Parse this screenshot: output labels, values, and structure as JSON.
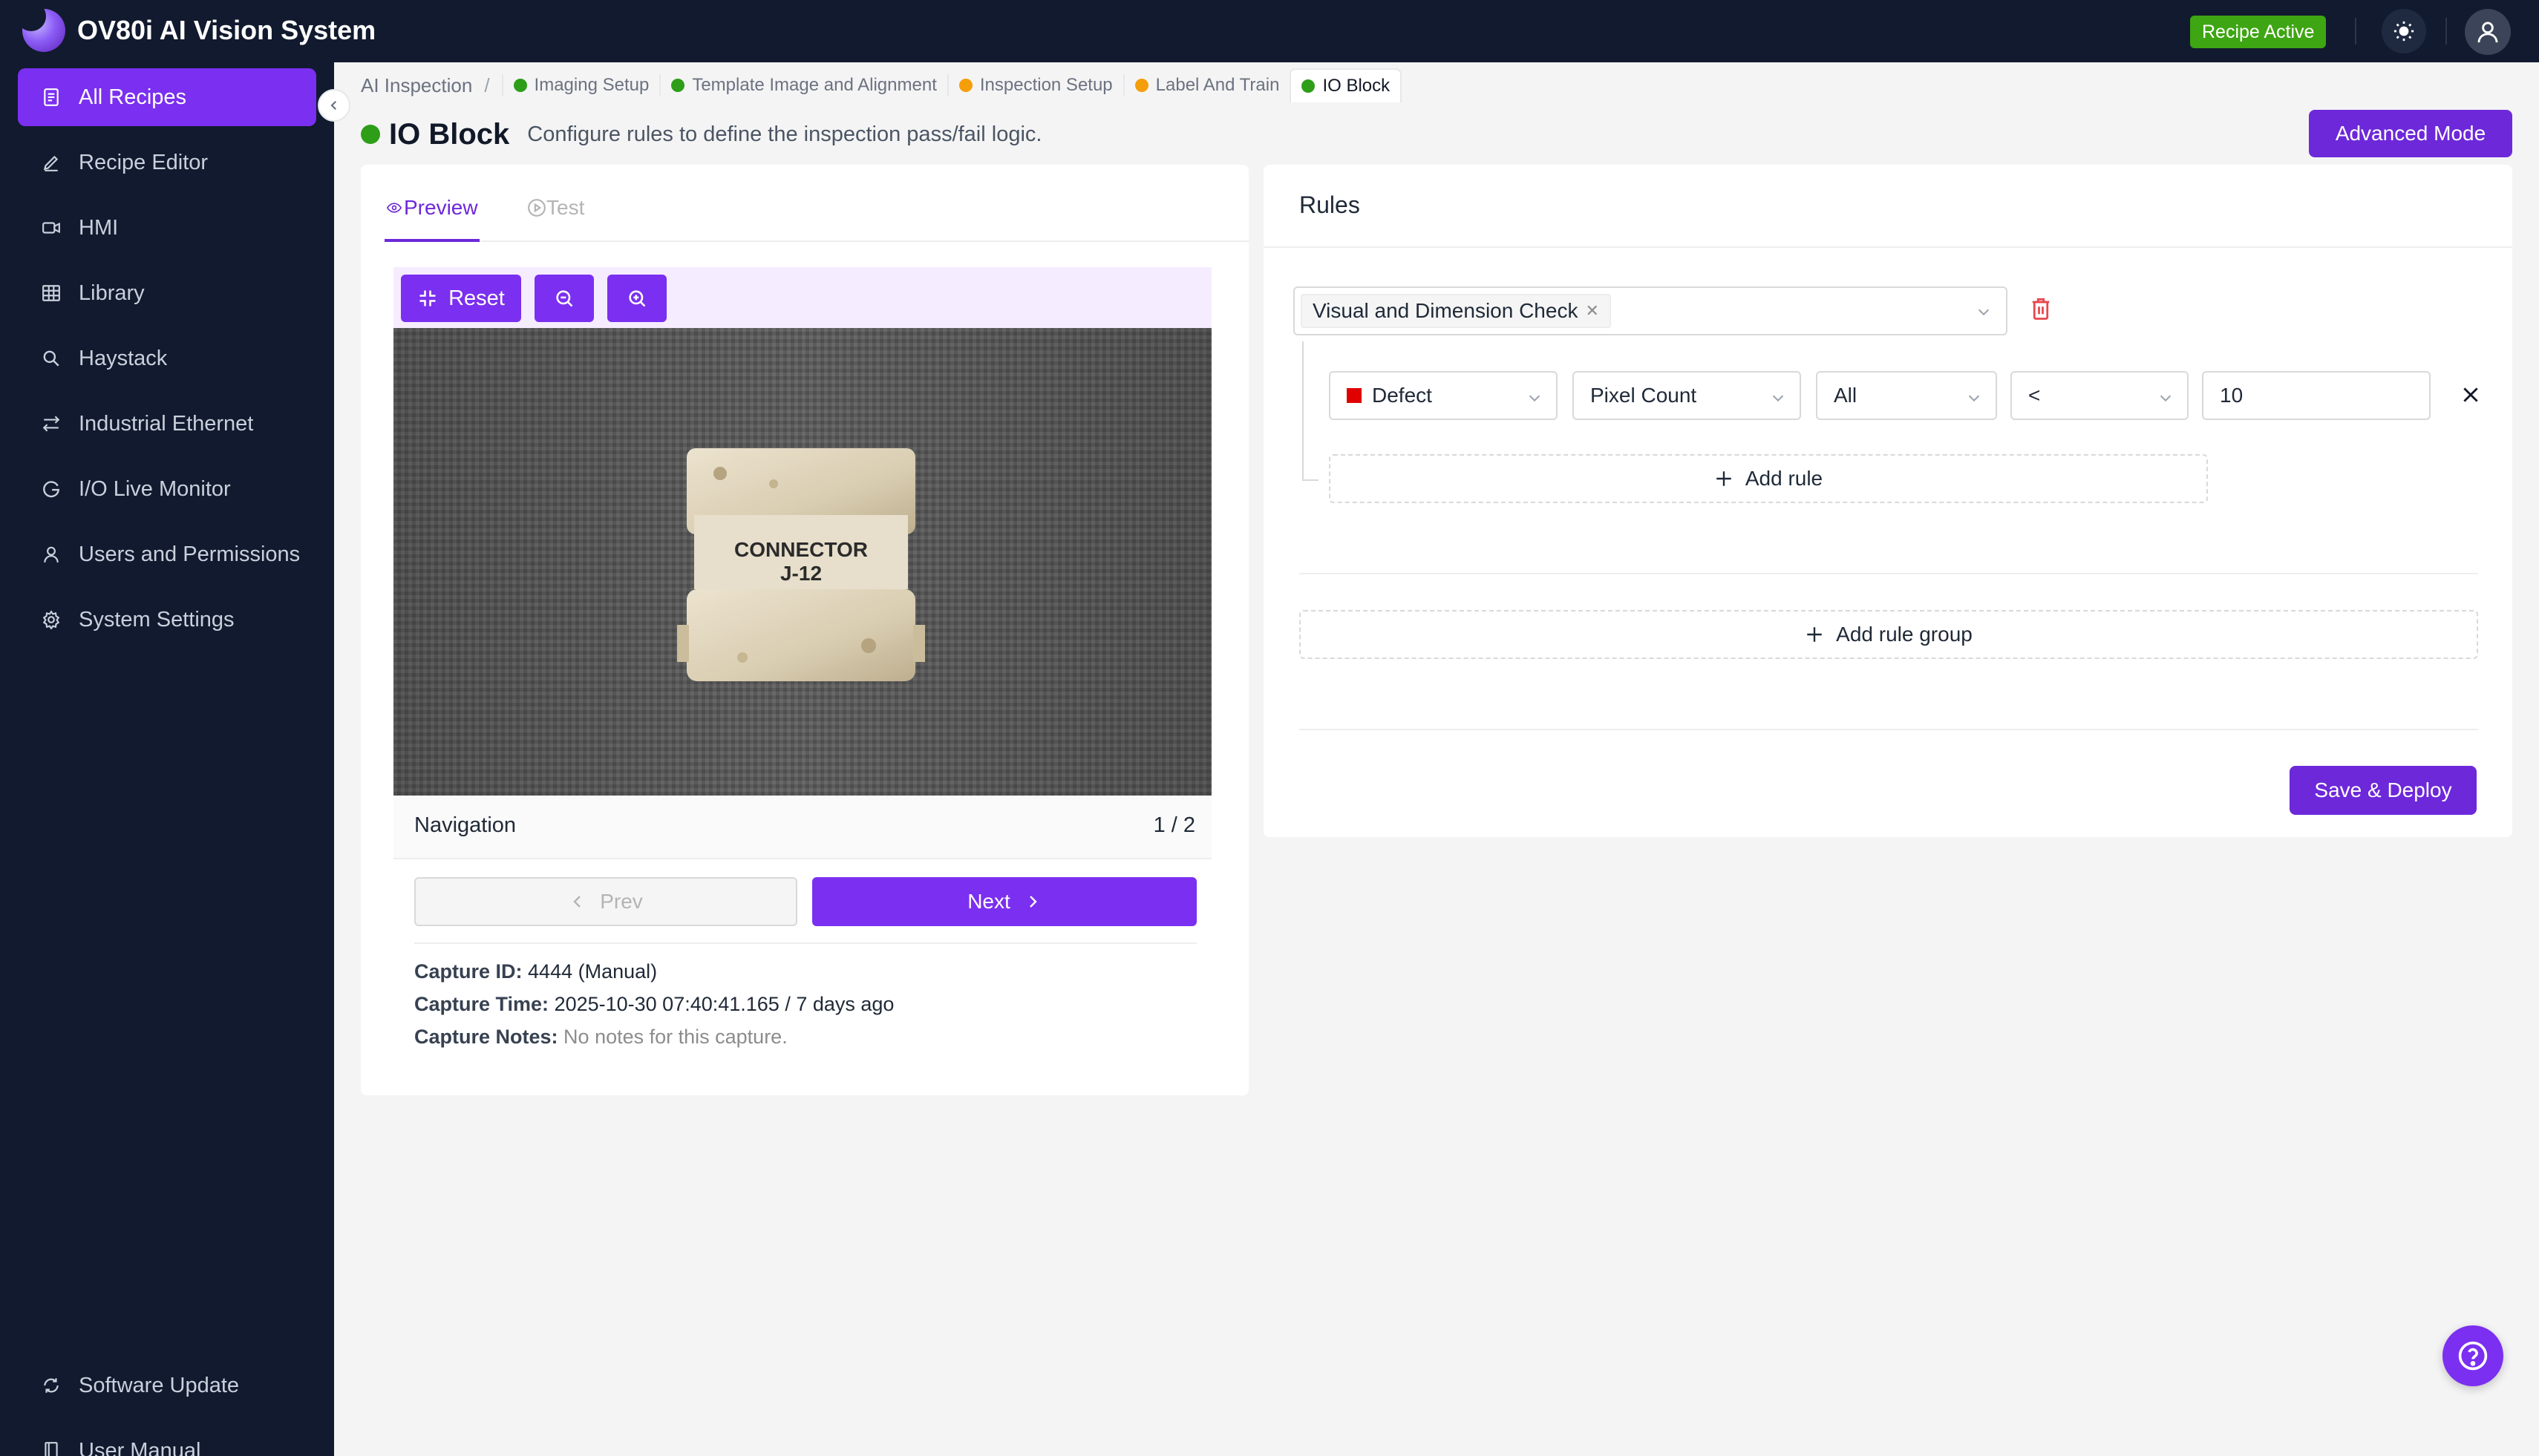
{
  "app": {
    "title": "OV80i AI Vision System",
    "status_badge": "Recipe Active",
    "brand_color": "#7b2ff0",
    "status_color": "#3ea513"
  },
  "sidebar": {
    "items": [
      {
        "label": "All Recipes",
        "icon": "document-list-icon",
        "active": true
      },
      {
        "label": "Recipe Editor",
        "icon": "pencil-icon"
      },
      {
        "label": "HMI",
        "icon": "video-icon"
      },
      {
        "label": "Library",
        "icon": "table-grid-icon"
      },
      {
        "label": "Haystack",
        "icon": "magnifier-icon"
      },
      {
        "label": "Industrial Ethernet",
        "icon": "ethernet-arrows-icon"
      },
      {
        "label": "I/O Live Monitor",
        "icon": "refresh-g-icon"
      },
      {
        "label": "Users and Permissions",
        "icon": "user-icon"
      },
      {
        "label": "System Settings",
        "icon": "gear-icon"
      }
    ],
    "bottom_items": [
      {
        "label": "Software Update",
        "icon": "sync-icon"
      },
      {
        "label": "User Manual",
        "icon": "book-icon"
      }
    ]
  },
  "breadcrumb": {
    "root": "AI Inspection",
    "separator": "/",
    "steps": [
      {
        "label": "Imaging Setup",
        "status_color": "#2e9e19"
      },
      {
        "label": "Template Image and Alignment",
        "status_color": "#2e9e19"
      },
      {
        "label": "Inspection Setup",
        "status_color": "#f59e0b"
      },
      {
        "label": "Label And Train",
        "status_color": "#f59e0b"
      },
      {
        "label": "IO Block",
        "status_color": "#2e9e19",
        "active": true
      }
    ]
  },
  "header": {
    "title": "IO Block",
    "status_color": "#2e9e19",
    "description": "Configure rules to define the inspection pass/fail logic.",
    "advanced_button": "Advanced Mode"
  },
  "preview": {
    "tabs": [
      {
        "label": "Preview",
        "icon": "eye-icon",
        "active": true
      },
      {
        "label": "Test",
        "icon": "play-circle-icon",
        "disabled": true
      }
    ],
    "toolbar": {
      "reset_label": "Reset",
      "zoom_out_icon": "zoom-out-icon",
      "zoom_in_icon": "zoom-in-icon"
    },
    "image_label_line1": "CONNECTOR",
    "image_label_line2": "J-12",
    "navigation_label": "Navigation",
    "page_indicator": "1 / 2",
    "prev_label": "Prev",
    "next_label": "Next",
    "capture_id_label": "Capture ID:",
    "capture_id_value": "4444 (Manual)",
    "capture_time_label": "Capture Time:",
    "capture_time_value": "2025-10-30 07:40:41.165 / 7 days ago",
    "capture_notes_label": "Capture Notes:",
    "capture_notes_value": "No notes for this capture."
  },
  "rules": {
    "title": "Rules",
    "group_tag": "Visual and Dimension Check",
    "rule": {
      "class": "Defect",
      "class_color": "#e00000",
      "metric": "Pixel Count",
      "scope": "All",
      "operator": "<",
      "value": "10"
    },
    "add_rule_label": "Add rule",
    "add_group_label": "Add rule group",
    "save_label": "Save & Deploy"
  }
}
